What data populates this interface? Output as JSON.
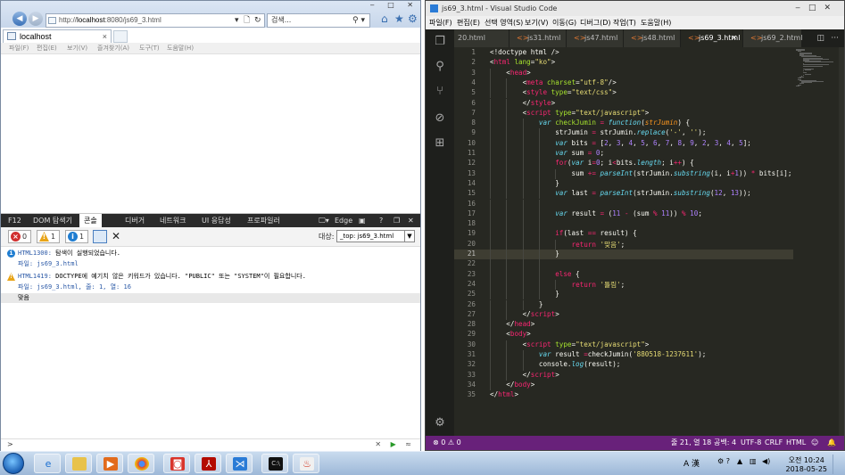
{
  "ie": {
    "address": "http://localhost:8080/js69_3.html",
    "address_prefix": "http://",
    "address_host": "localhost",
    "address_path": ":8080/js69_3.html",
    "search_placeholder": "검색...",
    "tab_title": "localhost",
    "tab_close": "×",
    "menu": [
      "파일(F)",
      "편집(E)",
      "보기(V)",
      "즐겨찾기(A)",
      "도구(T)",
      "도움말(H)"
    ],
    "f12": {
      "tabs": [
        "F12",
        "DOM 탐색기",
        "콘솔",
        "디버거",
        "네트워크",
        "UI 응답성",
        "프로파일러"
      ],
      "active_tab": "콘솔",
      "emulation": "Edge",
      "counts": {
        "errors": "0",
        "warnings": "1",
        "info": "1"
      },
      "target_label": "대상:",
      "target_value": "_top: js69_3.html",
      "messages": [
        {
          "type": "info",
          "code": "HTML1300:",
          "text": "탐색이 실행되었습니다.",
          "sub": "파일: js69_3.html"
        },
        {
          "type": "warning",
          "code": "HTML1419:",
          "text": "DOCTYPE에 예기치 않은 키워드가 있습니다. \"PUBLIC\" 또는 \"SYSTEM\"이 필요합니다.",
          "sub": "파일: js69_3.html, 줄: 1, 열: 16"
        }
      ],
      "result": "맞음",
      "prompt": ">"
    }
  },
  "vscode": {
    "title": "js69_3.html - Visual Studio Code",
    "menu": [
      "파일(F)",
      "편집(E)",
      "선택 영역(S)",
      "보기(V)",
      "이동(G)",
      "디버그(D)",
      "작업(T)",
      "도움말(H)"
    ],
    "tabs": [
      {
        "label": "20.html",
        "active": false
      },
      {
        "label": "js31.html",
        "active": false
      },
      {
        "label": "js47.html",
        "active": false
      },
      {
        "label": "js48.html",
        "active": false
      },
      {
        "label": "js69_3.html",
        "active": true
      },
      {
        "label": "js69_2.html",
        "active": false
      }
    ],
    "status": {
      "errors": "0",
      "warnings": "0",
      "position": "줄 21, 열 18",
      "spaces": "공백: 4",
      "encoding": "UTF-8",
      "eol": "CRLF",
      "language": "HTML"
    }
  },
  "taskbar": {
    "time": "오전 10:24",
    "date": "2018-05-25",
    "ime": "A 漢"
  },
  "colors": {
    "vscode_status": "#68217a",
    "editor_bg": "#272822",
    "ie_chrome": "#dbe6f4"
  }
}
